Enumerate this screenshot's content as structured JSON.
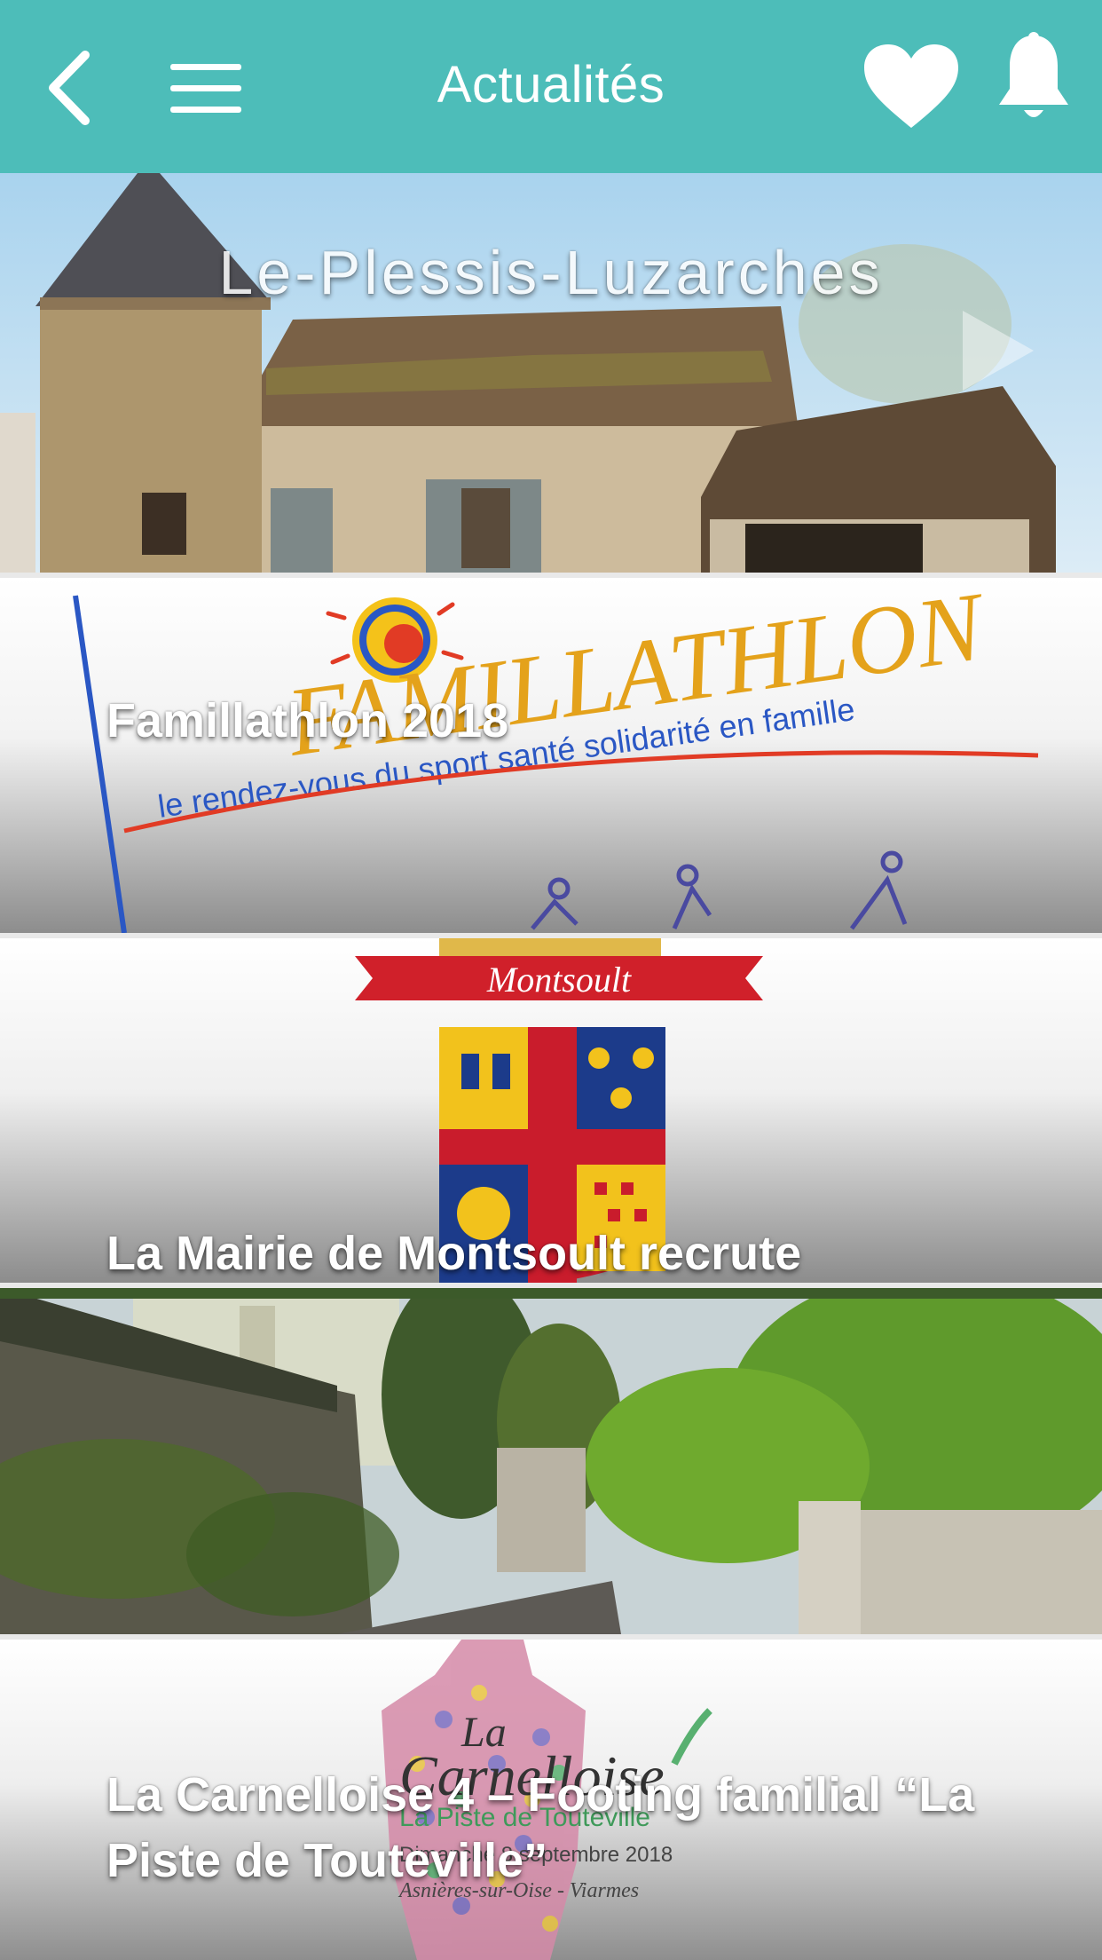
{
  "header": {
    "title": "Actualités",
    "back_icon": "chevron-left-icon",
    "menu_icon": "hamburger-icon",
    "favorites_icon": "heart-icon",
    "notifications_icon": "bell-icon",
    "background_color": "#4dbdb9"
  },
  "feed": {
    "items": [
      {
        "title": "Le-Plessis-Luzarches",
        "image": "village-tower-photo",
        "icon": "play-icon"
      },
      {
        "title": "Famillathlon 2018",
        "image": "famillathlon-logo",
        "logo_word": "FAMILLATHLON",
        "logo_tagline": "le rendez-vous du sport santé solidarité en famille"
      },
      {
        "title": "La Mairie de Montsoult recrute",
        "image": "montsoult-coat-of-arms",
        "logo_word": "Montsoult"
      },
      {
        "title": "",
        "image": "village-street-photo"
      },
      {
        "title": "La Carnelloise 4 – Footing familial “La Piste de Touteville”",
        "image": "carnelloise-poster",
        "logo_word": "La Carnelloise",
        "logo_sub": "La Piste de Touteville",
        "logo_date": "Dimanche 8 septembre 2018",
        "logo_place": "Asnières-sur-Oise - Viarmes"
      }
    ]
  }
}
